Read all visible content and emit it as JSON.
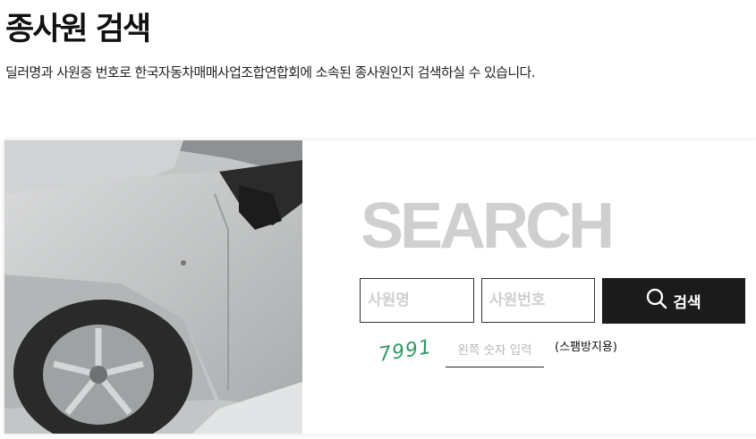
{
  "header": {
    "title": "종사원 검색",
    "description": "딜러명과 사원증 번호로 한국자동차매매사업조합연합회에 소속된 종사원인지 검색하실 수 있습니다."
  },
  "search": {
    "heading": "SEARCH",
    "name_placeholder": "사원명",
    "number_placeholder": "사원번호",
    "button_label": "검색",
    "captcha_code": "7991",
    "captcha_placeholder": "왼쪽 숫자 입력",
    "captcha_note": "(스팸방지용)"
  },
  "colors": {
    "button_bg": "#1b1b1b",
    "heading_color": "#cfcfcf",
    "captcha_color": "#2e9a63"
  },
  "icons": {
    "search_button": "search-icon"
  }
}
